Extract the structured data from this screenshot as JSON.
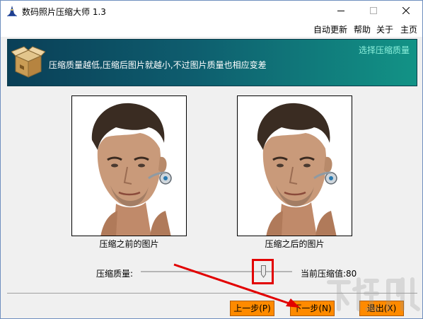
{
  "window": {
    "title": "数码照片压缩大师 1.3",
    "icon": "wizard-hat-icon"
  },
  "window_controls": {
    "minimize_icon": "minimize-icon",
    "maximize_icon": "maximize-icon",
    "close_icon": "close-icon"
  },
  "menu": {
    "items": [
      {
        "label": "自动更新"
      },
      {
        "label": "帮助"
      },
      {
        "label": "关于"
      },
      {
        "label": "主页"
      }
    ]
  },
  "banner": {
    "icon": "package-box-icon",
    "description": "压缩质量越低,压缩后图片就越小,不过图片质量也相应变差",
    "step_title": "选择压缩质量"
  },
  "preview": {
    "before_caption": "压缩之前的图片",
    "after_caption": "压缩之后的图片"
  },
  "quality": {
    "label": "压缩质量:",
    "current_label": "当前压缩值:80",
    "value": 80,
    "range": [
      0,
      100
    ]
  },
  "buttons": {
    "prev_label": "上一步(P)",
    "next_label": "下一步(N)",
    "exit_label": "退出(X)"
  },
  "colors": {
    "banner_start": "#0a3f57",
    "banner_end": "#129386",
    "button_orange": "#ff8a00",
    "highlight_red": "#e20000"
  }
}
